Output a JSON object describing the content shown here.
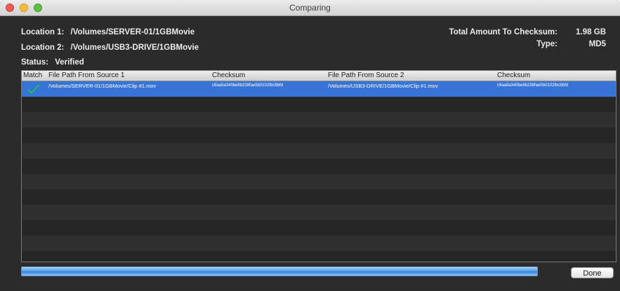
{
  "window": {
    "title": "Comparing"
  },
  "info": {
    "location1_label": "Location 1:",
    "location1_value": "/Volumes/SERVER-01/1GBMovie",
    "location2_label": "Location 2:",
    "location2_value": "/Volumes/USB3-DRIVE/1GBMovie",
    "status_label": "Status:",
    "status_value": "Verified",
    "total_label": "Total Amount To Checksum:",
    "total_value": "1.98 GB",
    "type_label": "Type:",
    "type_value": "MD5"
  },
  "table": {
    "columns": [
      "Match",
      "File Path From Source 1",
      "Checksum",
      "File Path From Source 2",
      "Checksum"
    ],
    "rows": [
      {
        "match": "check-icon",
        "path1": "/Volumes/SERVER-01/1GBMovie/Clip #1.mov",
        "checksum1": "c9aa9a340be8b238fae5b0102fbc9bfd",
        "path2": "/Volumes/USB3-DRIVE/1GBMovie/Clip #1.mov",
        "checksum2": "c9aa9a340be8b238fae5b0102fbc9bfd"
      }
    ]
  },
  "progress": {
    "value": 1.0
  },
  "buttons": {
    "done": "Done"
  },
  "colors": {
    "selection": "#3874d8",
    "check": "#2bb0a0"
  }
}
